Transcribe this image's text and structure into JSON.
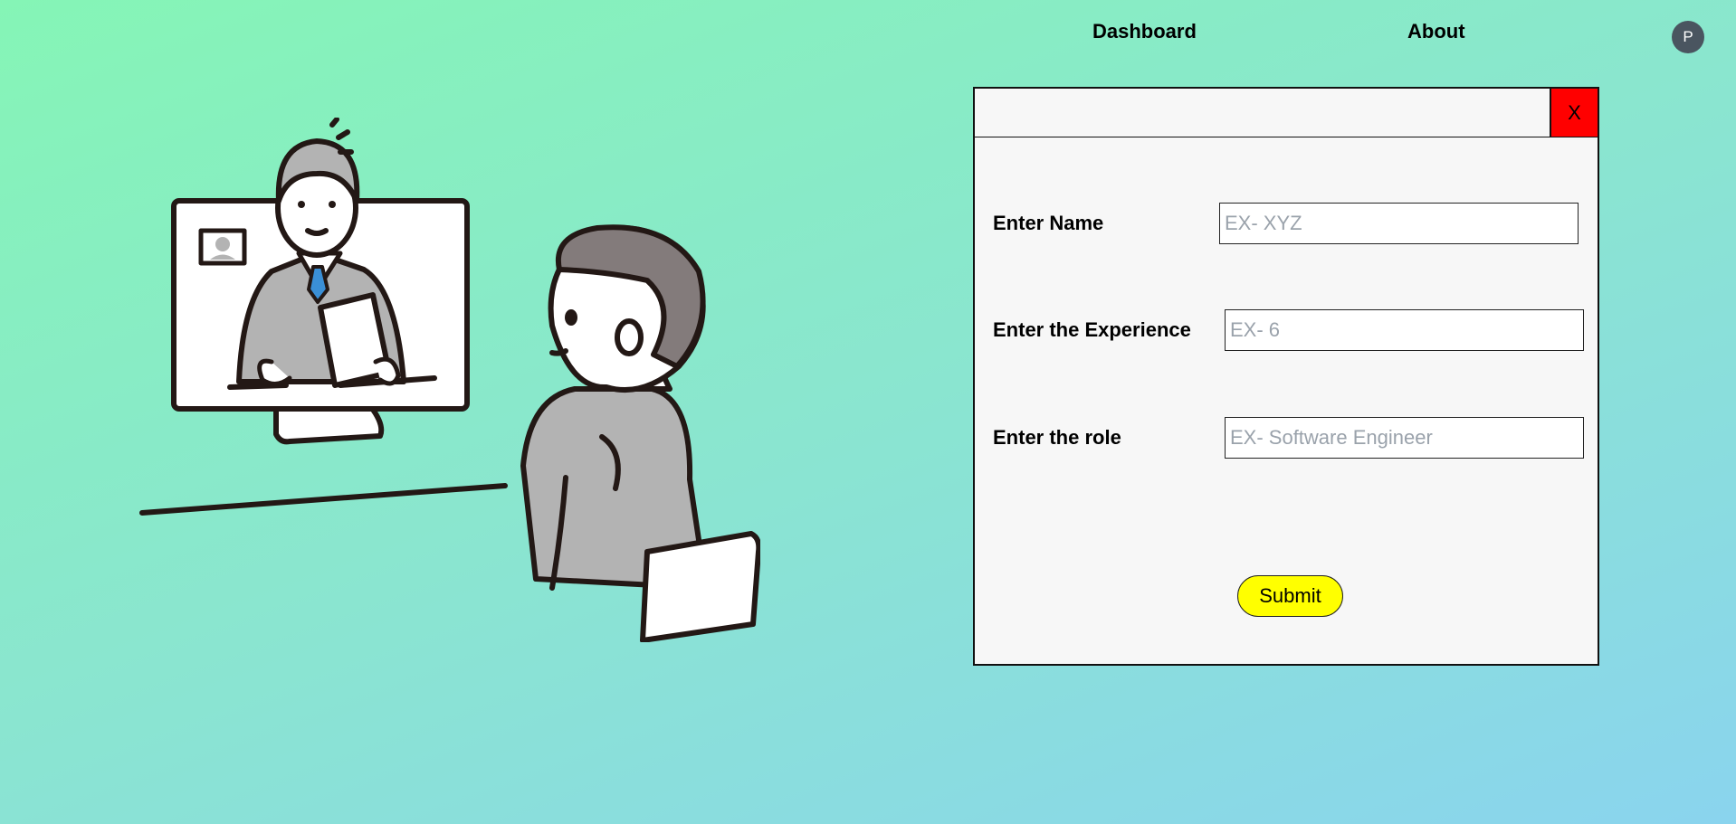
{
  "nav": {
    "dashboard": "Dashboard",
    "about": "About"
  },
  "user": {
    "avatar_initial": "P"
  },
  "modal": {
    "close_label": "X",
    "fields": [
      {
        "label": "Enter Name",
        "placeholder": "EX- XYZ",
        "value": ""
      },
      {
        "label": "Enter the Experience",
        "placeholder": "EX- 6",
        "value": ""
      },
      {
        "label": "Enter the role",
        "placeholder": "EX- Software Engineer",
        "value": ""
      }
    ],
    "submit_label": "Submit"
  },
  "colors": {
    "background_start": "#85f5b6",
    "background_end": "#8ad4ee",
    "close_button": "#ff0000",
    "submit_button": "#ffff00",
    "avatar": "#4a5560"
  }
}
